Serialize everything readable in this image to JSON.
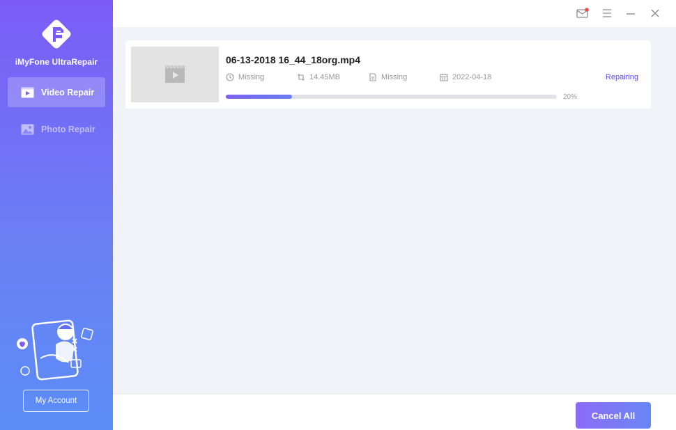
{
  "app": {
    "name": "iMyFone UltraRepair"
  },
  "sidebar": {
    "items": [
      {
        "label": "Video Repair",
        "icon": "video-icon",
        "active": true
      },
      {
        "label": "Photo Repair",
        "icon": "photo-icon",
        "active": false
      }
    ],
    "account_label": "My Account"
  },
  "titlebar": {
    "icons": [
      "mail-icon",
      "menu-icon",
      "minimize-icon",
      "close-icon"
    ]
  },
  "file": {
    "name": "06-13-2018 16_44_18org.mp4",
    "duration": "Missing",
    "size": "14.45MB",
    "resolution": "Missing",
    "date": "2022-04-18",
    "status": "Repairing",
    "progress_label": "20%",
    "progress": 0.2
  },
  "footer": {
    "cancel_all_label": "Cancel All"
  },
  "colors": {
    "accent": "#6b5cf0",
    "status": "#5b4ce0"
  }
}
